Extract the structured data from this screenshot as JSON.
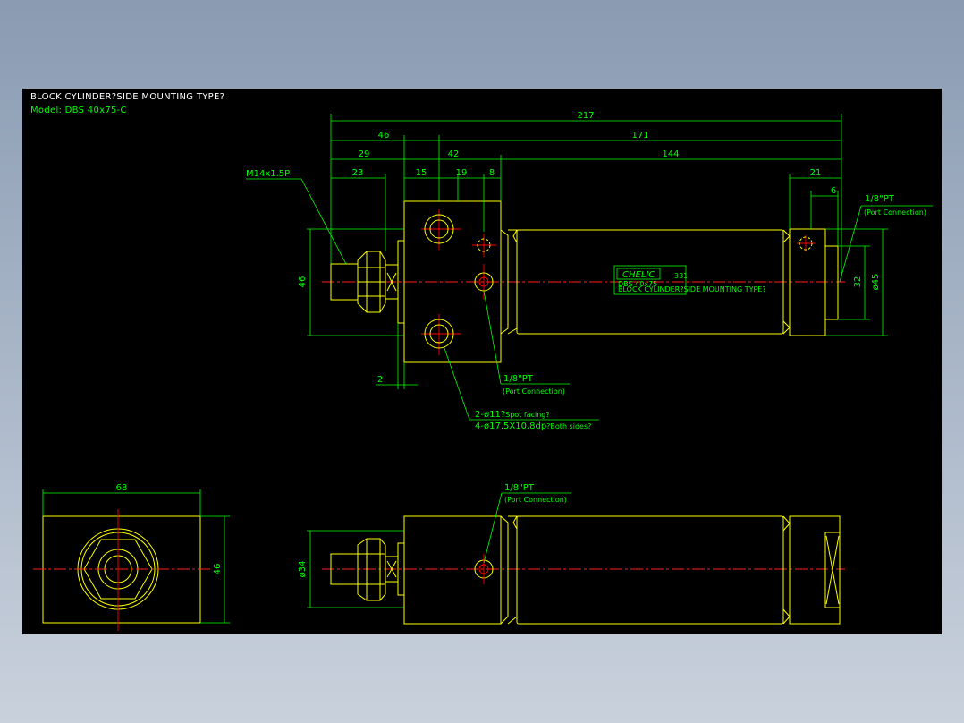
{
  "title": "BLOCK CYLINDER?SIDE MOUNTING TYPE?",
  "model": "Model: DBS 40x75-C",
  "dimensions": {
    "d217": "217",
    "d46": "46",
    "d171": "171",
    "d29": "29",
    "d42": "42",
    "d144": "144",
    "d23": "23",
    "d15": "15",
    "d19": "19",
    "d8": "8",
    "d21": "21",
    "d6": "6",
    "d46_left": "46",
    "d2": "2",
    "d32": "32",
    "d45": "ø45",
    "d68": "68",
    "d46_end": "46",
    "d34": "ø34"
  },
  "callouts": {
    "thread": "M14x1.5P",
    "port_top_size": "1/8\"PT",
    "port_top_note": "(Port Connection)",
    "port_mid_size": "1/8\"PT",
    "port_mid_note": "(Port Connection)",
    "holes_line1": "2-ø11?",
    "holes_line1_note": "Spot facing?",
    "holes_line2": "4-ø17.5X10.8dp",
    "holes_line2_note": "?Both sides?",
    "port_bottom_size": "1/8\"PT",
    "port_bottom_note": "(Port Connection)"
  },
  "label_plate": {
    "brand": "CHELIC",
    "code": "331",
    "line1": "DBS 40x75",
    "line2": "BLOCK CYLINDER?SIDE MOUNTING TYPE?"
  },
  "colors": {
    "background": "#000000",
    "outline": "#ffff00",
    "dimension": "#00ff00",
    "centerline": "#ff0000",
    "title": "#ffffff"
  }
}
